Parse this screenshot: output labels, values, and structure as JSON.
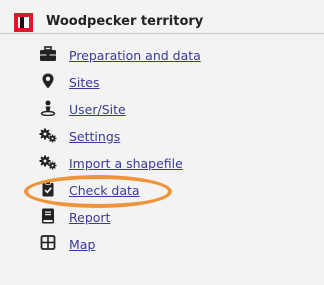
{
  "panel": {
    "title": "Woodpecker territory",
    "logo_color": "#e0162b"
  },
  "menu": {
    "link_color": "#3a3a9a",
    "items": [
      {
        "label": "Preparation and data",
        "icon": "toolbox-icon"
      },
      {
        "label": "Sites",
        "icon": "map-pin-icon"
      },
      {
        "label": "User/Site",
        "icon": "user-location-icon"
      },
      {
        "label": "Settings",
        "icon": "gears-icon"
      },
      {
        "label": "Import a shapefile",
        "icon": "gears-icon"
      },
      {
        "label": "Check data",
        "icon": "clipboard-check-icon"
      },
      {
        "label": "Report",
        "icon": "book-icon"
      },
      {
        "label": "Map",
        "icon": "grid-icon"
      }
    ]
  },
  "annotation": {
    "highlighted_item": "Check data",
    "highlight_color": "#f0943c"
  }
}
